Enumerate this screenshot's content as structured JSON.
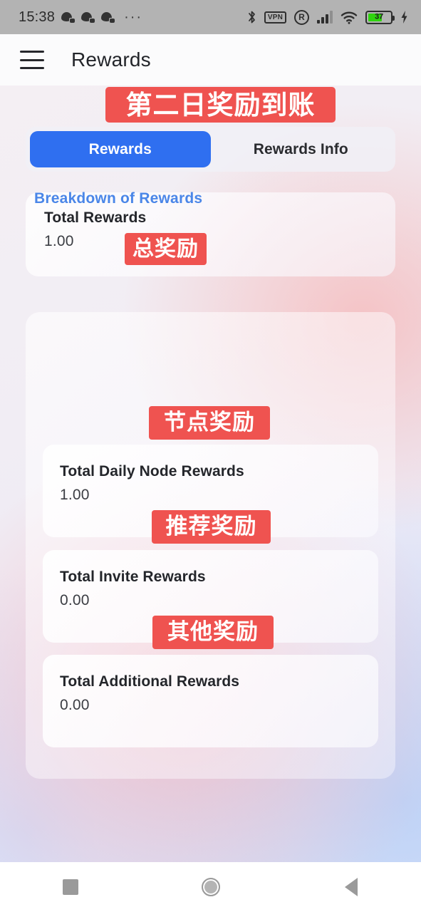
{
  "status_bar": {
    "clock": "15:38",
    "notification_icons": [
      "notification-icon",
      "notification-icon",
      "notification-icon"
    ],
    "overflow": "···",
    "bluetooth": "bluetooth-icon",
    "vpn_label": "VPN",
    "roaming_label": "R",
    "signal": "signal-bars-icon",
    "wifi": "wifi-icon",
    "battery_percent": "37",
    "charging": "charging-bolt-icon"
  },
  "app_bar": {
    "menu_icon": "hamburger-menu-icon",
    "title": "Rewards"
  },
  "tabs": [
    {
      "label": "Rewards",
      "active": true
    },
    {
      "label": "Rewards Info",
      "active": false
    }
  ],
  "total_rewards": {
    "label": "Total Rewards",
    "value": "1.00"
  },
  "breakdown": {
    "title": "Breakdown of Rewards",
    "items": [
      {
        "label": "Total Daily Node Rewards",
        "value": "1.00"
      },
      {
        "label": "Total Invite Rewards",
        "value": "0.00"
      },
      {
        "label": "Total Additional Rewards",
        "value": "0.00"
      }
    ]
  },
  "annotations": {
    "banner": "第二日奖励到账",
    "total": "总奖励",
    "node": "节点奖励",
    "invite": "推荐奖励",
    "additional": "其他奖励"
  },
  "nav_bar": {
    "recents": "recents-square-icon",
    "home": "home-circle-icon",
    "back": "back-triangle-icon"
  },
  "colors": {
    "accent_blue": "#2f6ff0",
    "link_blue": "#4a86e8",
    "annotation_red": "#ef5350",
    "battery_green": "#2fd40e"
  }
}
